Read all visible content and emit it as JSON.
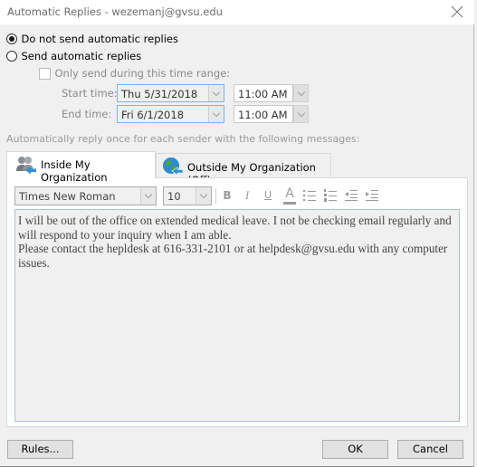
{
  "window": {
    "title": "Automatic Replies - wezemanj@gvsu.edu",
    "close_icon": "close-icon"
  },
  "options": {
    "do_not_send": {
      "label": "Do not send automatic replies",
      "selected": true
    },
    "send": {
      "label": "Send automatic replies",
      "selected": false
    }
  },
  "time_range": {
    "checkbox_label": "Only send during this time range:",
    "checked": false,
    "start_label": "Start time:",
    "start_date": "Thu 5/31/2018",
    "start_time": "11:00 AM",
    "end_label": "End time:",
    "end_date": "Fri 6/1/2018",
    "end_time": "11:00 AM"
  },
  "instruction": "Automatically reply once for each sender with the following messages:",
  "tabs": [
    {
      "label": "Inside My Organization",
      "icon": "people-icon",
      "active": true
    },
    {
      "label": "Outside My Organization (Off)",
      "icon": "globe-icon",
      "active": false
    }
  ],
  "toolbar": {
    "font": "Times New Roman",
    "size": "10",
    "bold": "B",
    "italic": "I",
    "underline": "U",
    "font_color": "A",
    "bullets_icon": "bullets-icon",
    "numbering_icon": "numbering-icon",
    "decrease_indent_icon": "decrease-indent-icon",
    "increase_indent_icon": "increase-indent-icon"
  },
  "message": {
    "line1": "I will be out of the office on extended medical leave. I not be checking email regularly and will respond to your inquiry when I am able.",
    "line2": "Please contact the hepldesk at 616-331-2101 or at helpdesk@gvsu.edu with any computer issues."
  },
  "buttons": {
    "rules": "Rules...",
    "ok": "OK",
    "cancel": "Cancel"
  },
  "colors": {
    "focus_border": "#7eb4ea",
    "dialog_bg": "#f0f0f0"
  }
}
